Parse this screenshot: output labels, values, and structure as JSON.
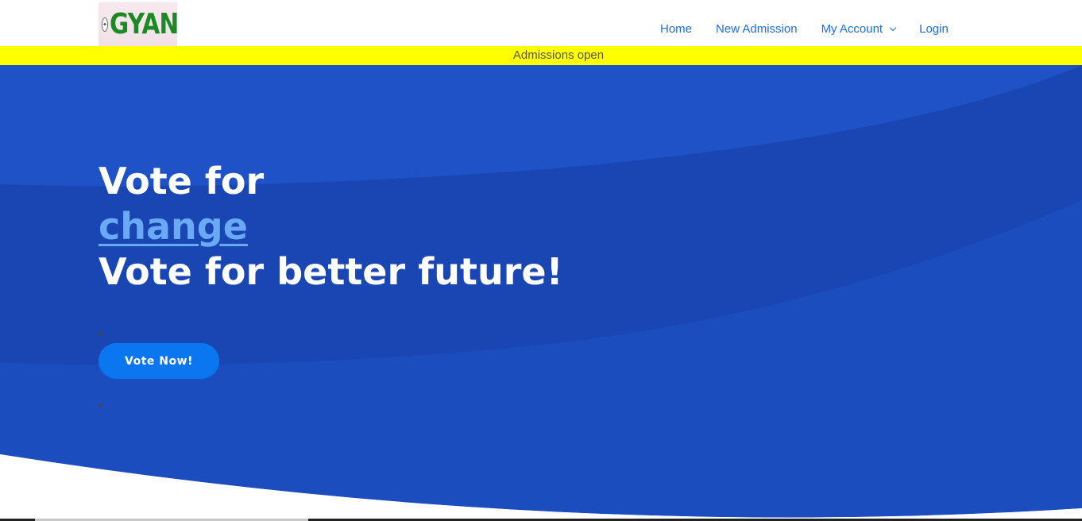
{
  "header": {
    "logo": {
      "text": "GYAN",
      "emblem": "emblem-icon"
    },
    "nav": [
      {
        "label": "Home"
      },
      {
        "label": "New Admission"
      },
      {
        "label": "My Account",
        "icon": "chevron-down-icon"
      },
      {
        "label": "Login"
      }
    ]
  },
  "announcement": {
    "text": "Admissions open",
    "background": "#ffff00"
  },
  "hero": {
    "line1": "Vote for",
    "highlight": "change",
    "line3": "Vote for better future!",
    "cta_label": "Vote Now!",
    "colors": {
      "background": "#1c4fbf",
      "highlight": "#6aa9f5",
      "button": "#0a76f0"
    }
  }
}
